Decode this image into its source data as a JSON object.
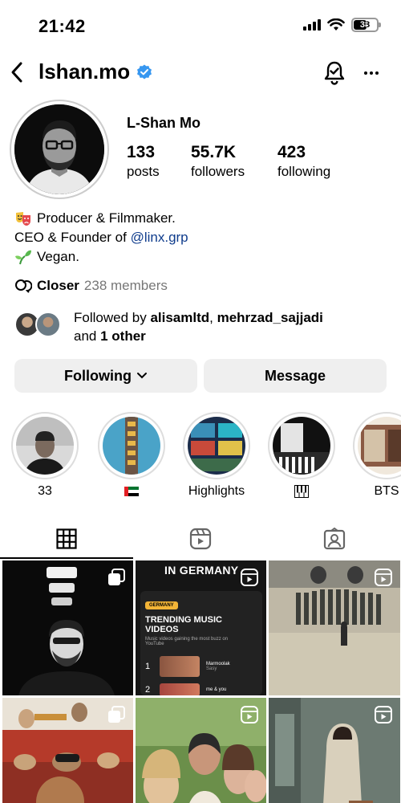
{
  "status_bar": {
    "time": "21:42",
    "battery": "38"
  },
  "header": {
    "username": "lshan.mo"
  },
  "profile": {
    "display_name": "L-Shan Mo",
    "stats": [
      {
        "value": "133",
        "label": "posts"
      },
      {
        "value": "55.7K",
        "label": "followers"
      },
      {
        "value": "423",
        "label": "following"
      }
    ],
    "bio": {
      "line1": "Producer & Filmmaker.",
      "line2_prefix": "CEO & Founder of ",
      "line2_link": "@linx.grp",
      "line3": "Vegan."
    },
    "closer": {
      "name": "Closer",
      "members": "238 members"
    },
    "followed_by": {
      "prefix": "Followed by ",
      "user1": "alisamltd",
      "sep": ", ",
      "user2": "mehrzad_sajjadi",
      "and": "and ",
      "other": "1 other"
    }
  },
  "buttons": {
    "following": "Following",
    "message": "Message"
  },
  "highlights": [
    {
      "label": "33"
    },
    {
      "label": ""
    },
    {
      "label": "Highlights"
    },
    {
      "label": ""
    },
    {
      "label": "BTS"
    }
  ],
  "tabs": [
    "grid-icon",
    "reels-icon",
    "tagged-icon"
  ],
  "grid": {
    "post2_overlay": "IN GERMANY",
    "post2_tag": "GERMANY",
    "post2_heading": "TRENDING MUSIC VIDEOS",
    "post2_sub": "Music videos gaining the most buzz on YouTube",
    "post2_rank1": "1",
    "post2_title1": "Marmoolak",
    "post2_artist1": "Sasy",
    "post2_rank2": "2",
    "post2_title2": "me & you"
  },
  "colors": {
    "link": "#0f3c8c",
    "verified": "#3797f0",
    "button_bg": "#efefef"
  }
}
